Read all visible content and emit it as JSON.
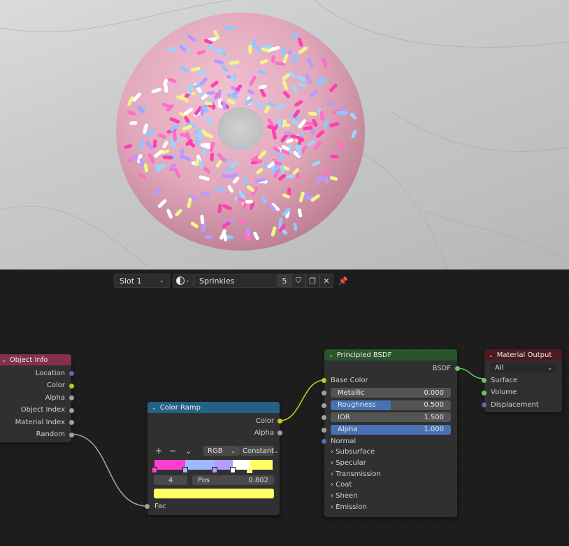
{
  "toolbar": {
    "slot": "Slot 1",
    "material_name": "Sprinkles",
    "user_count": "5"
  },
  "object_info": {
    "title": "Object Info",
    "outputs": [
      "Location",
      "Color",
      "Alpha",
      "Object Index",
      "Material Index",
      "Random"
    ]
  },
  "color_ramp": {
    "title": "Color Ramp",
    "outputs": [
      "Color",
      "Alpha"
    ],
    "add": "+",
    "remove": "−",
    "mode": "RGB",
    "interpolation": "Constant",
    "stop_index": "4",
    "pos_label": "Pos",
    "pos_value": "0.802",
    "input": "Fac",
    "stops": [
      {
        "pos": 0.0,
        "color": "#ff3fd0"
      },
      {
        "pos": 0.26,
        "color": "#9db8ff"
      },
      {
        "pos": 0.51,
        "color": "#b59bff"
      },
      {
        "pos": 0.66,
        "color": "#ffffff"
      },
      {
        "pos": 0.802,
        "color": "#ffff66"
      }
    ],
    "selected_color": "#ffff66"
  },
  "bsdf": {
    "title": "Principled BSDF",
    "output": "BSDF",
    "base_color": "Base Color",
    "fields": [
      {
        "label": "Metallic",
        "value": "0.000",
        "fill": 0.0
      },
      {
        "label": "Roughness",
        "value": "0.500",
        "fill": 0.5
      },
      {
        "label": "IOR",
        "value": "1.500",
        "fill": 0.0
      },
      {
        "label": "Alpha",
        "value": "1.000",
        "fill": 1.0
      }
    ],
    "normal": "Normal",
    "panels": [
      "Subsurface",
      "Specular",
      "Transmission",
      "Coat",
      "Sheen",
      "Emission"
    ]
  },
  "material_output": {
    "title": "Material Output",
    "target": "All",
    "inputs": [
      "Surface",
      "Volume",
      "Displacement"
    ]
  },
  "colors": {
    "input_header": "#83314a",
    "converter_header": "#246283",
    "shader_header": "#28552a",
    "output_header": "#4c1a22",
    "field_fill": "#4772b3",
    "socket_yellow": "#c7c729",
    "socket_gray": "#a1a1a1",
    "socket_purple": "#6363c7",
    "socket_green": "#63c763"
  }
}
